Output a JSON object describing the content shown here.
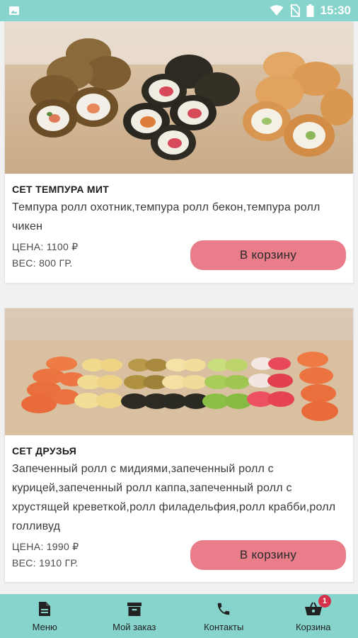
{
  "status_bar": {
    "time": "15:30",
    "icons": [
      "image-icon",
      "wifi-icon",
      "no-sim-icon",
      "battery-icon"
    ]
  },
  "products": [
    {
      "title": "СЕТ ТЕМПУРА МИТ",
      "description": "Темпура ролл охотник,темпура ролл бекон,темпура ролл чикен",
      "price": "ЦЕНА: 1100 ₽",
      "weight": "ВЕС: 800 ГР.",
      "button": "В корзину"
    },
    {
      "title": "СЕТ ДРУЗЬЯ",
      "description": "Запеченный ролл с мидиями,запеченный ролл с курицей,запеченный ролл каппа,запеченный ролл с хрустящей креветкой,ролл филадельфия,ролл крабби,ролл голливуд",
      "price": "ЦЕНА: 1990 ₽",
      "weight": "ВЕС: 1910 ГР.",
      "button": "В корзину"
    }
  ],
  "bottom_nav": {
    "items": [
      {
        "label": "Меню",
        "icon": "document-icon"
      },
      {
        "label": "Мой заказ",
        "icon": "archive-icon"
      },
      {
        "label": "Контакты",
        "icon": "phone-icon"
      },
      {
        "label": "Корзина",
        "icon": "basket-icon",
        "badge": "1"
      }
    ]
  },
  "colors": {
    "accent": "#86d4cc",
    "button": "#e97e8a",
    "badge": "#d6314a"
  }
}
